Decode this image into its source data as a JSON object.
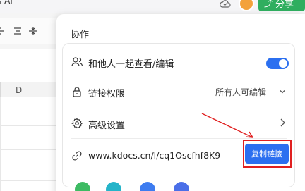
{
  "doc": {
    "title": "s AI"
  },
  "header": {
    "share_label": "分享"
  },
  "toolbar": {
    "icons": [
      "align-center-icon",
      "align-justify-icon",
      "vertical-align-icon"
    ]
  },
  "sheet": {
    "column_header": "D"
  },
  "panel": {
    "title": "协作",
    "rows": [
      {
        "label": "和他人一起查看/编辑",
        "toggle_on": true
      },
      {
        "label": "链接权限",
        "value": "所有人可编辑"
      },
      {
        "label": "高级设置"
      },
      {
        "link": "www.kdocs.cn/l/cq1Oscfhf8K9",
        "button": "复制链接"
      }
    ]
  },
  "colors": {
    "accent_blue": "#2b6ff0",
    "share_green": "#2fae5f",
    "highlight_red": "#e02020"
  }
}
